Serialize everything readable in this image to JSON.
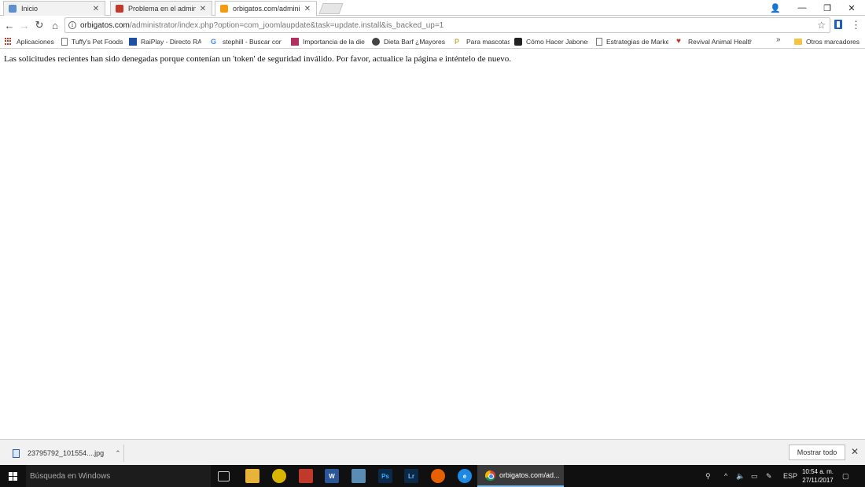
{
  "browser": {
    "tabs": [
      {
        "label": "Inicio",
        "icon": "bookmark-favicon",
        "color": "#5b8fd0"
      },
      {
        "label": "Problema en el admin de",
        "icon": "forum-favicon",
        "color": "#c0392b"
      },
      {
        "label": "orbigatos.com/administr",
        "icon": "joomla-favicon",
        "color": "#f39c12"
      }
    ],
    "window_controls": {
      "profile": "👤",
      "minimize": "—",
      "restore": "❐",
      "close": "✕"
    },
    "address": {
      "host": "orbigatos.com",
      "path": "/administrator/index.php?option=com_joomlaupdate&task=update.install&is_backed_up=1"
    },
    "bookmarks": [
      {
        "label": "Aplicaciones",
        "icon": "apps-grid-icon"
      },
      {
        "label": "Tuffy's Pet Foods",
        "icon": "page-icon"
      },
      {
        "label": "RaiPlay - Directo RAI",
        "icon": "raiplay-icon"
      },
      {
        "label": "stephill - Buscar con",
        "icon": "google-icon"
      },
      {
        "label": "Importancia de la die",
        "icon": "site-icon"
      },
      {
        "label": "Dieta Barf ¿Mayores",
        "icon": "dog-icon"
      },
      {
        "label": "Para mascotas",
        "icon": "pet-icon"
      },
      {
        "label": "Cómo Hacer Jabones",
        "icon": "soap-icon"
      },
      {
        "label": "Estrategias de Marke",
        "icon": "page-icon"
      },
      {
        "label": "Revival Animal Health",
        "icon": "heart-icon"
      }
    ],
    "bookmarks_overflow": "»",
    "other_bookmarks": "Otros marcadores"
  },
  "page": {
    "message": "Las solicitudes recientes han sido denegadas porque contenían un 'token' de seguridad inválido. Por favor, actualice la página e inténtelo de nuevo."
  },
  "downloads": {
    "file_name": "23795792_101554....jpg",
    "show_all": "Mostrar todo"
  },
  "taskbar": {
    "search_placeholder": "Búsqueda en Windows",
    "active_app_label": "orbigatos.com/ad...",
    "language": "ESP",
    "time": "10:54 a. m.",
    "date": "27/11/2017"
  }
}
